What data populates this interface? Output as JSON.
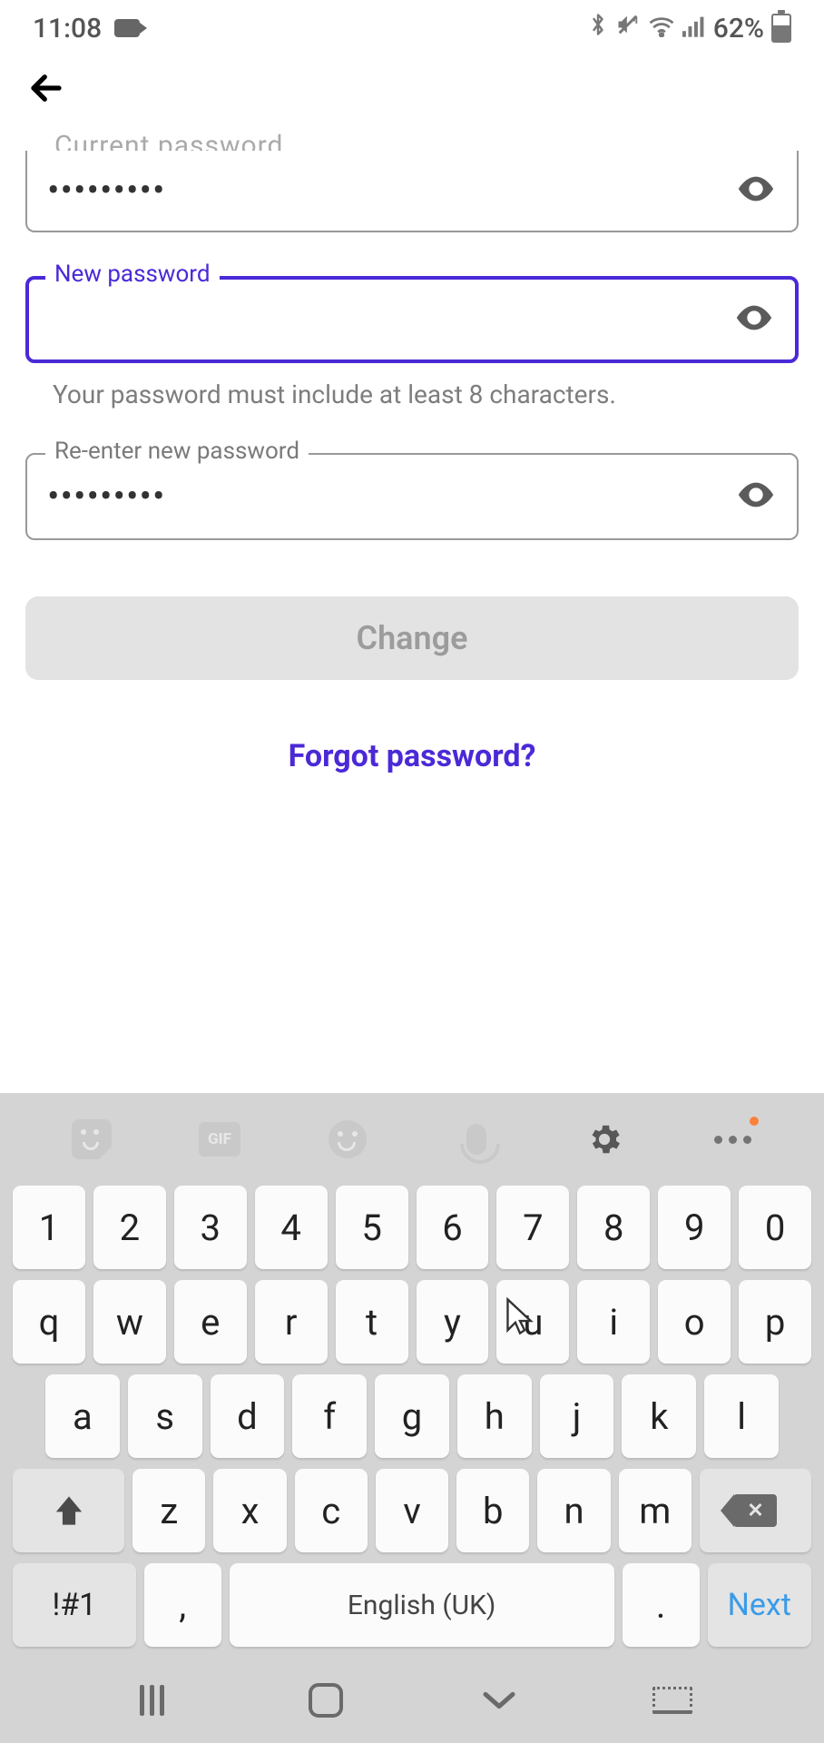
{
  "status_bar": {
    "time": "11:08",
    "battery_text": "62%"
  },
  "form": {
    "current_password": {
      "label_cutoff": "Current password",
      "value_dots": "•••••••••"
    },
    "new_password": {
      "label": "New password",
      "value": "",
      "hint": "Your password must include at least 8 characters."
    },
    "reenter": {
      "label": "Re-enter new password",
      "value_dots": "•••••••••"
    },
    "change_btn": "Change",
    "forgot_link": "Forgot password?"
  },
  "keyboard": {
    "toolbar_gif": "GIF",
    "row1": [
      "1",
      "2",
      "3",
      "4",
      "5",
      "6",
      "7",
      "8",
      "9",
      "0"
    ],
    "row2": [
      "q",
      "w",
      "e",
      "r",
      "t",
      "y",
      "u",
      "i",
      "o",
      "p"
    ],
    "row3": [
      "a",
      "s",
      "d",
      "f",
      "g",
      "h",
      "j",
      "k",
      "l"
    ],
    "row4": [
      "z",
      "x",
      "c",
      "v",
      "b",
      "n",
      "m"
    ],
    "sym": "!#1",
    "comma": ",",
    "space": "English (UK)",
    "period": ".",
    "next": "Next"
  }
}
